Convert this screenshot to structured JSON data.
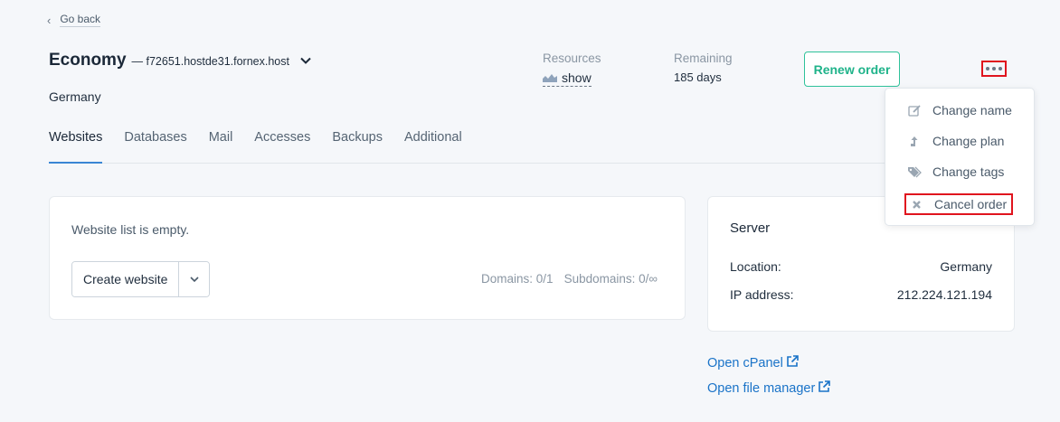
{
  "nav": {
    "back_label": "Go back"
  },
  "header": {
    "plan": "Economy",
    "host": "— f72651.hostde31.fornex.host",
    "country": "Germany",
    "resources_label": "Resources",
    "resources_value": "show",
    "remaining_label": "Remaining",
    "remaining_value": "185 days",
    "renew_label": "Renew order"
  },
  "tabs": [
    {
      "label": "Websites",
      "active": true
    },
    {
      "label": "Databases"
    },
    {
      "label": "Mail"
    },
    {
      "label": "Accesses"
    },
    {
      "label": "Backups"
    },
    {
      "label": "Additional"
    }
  ],
  "websites": {
    "empty_text": "Website list is empty.",
    "create_label": "Create website",
    "domains": "Domains: 0/1",
    "subdomains": "Subdomains: 0/∞"
  },
  "server": {
    "title": "Server",
    "location_label": "Location:",
    "location_value": "Germany",
    "ip_label": "IP address:",
    "ip_value": "212.224.121.194"
  },
  "links": {
    "cpanel": "Open cPanel",
    "file_manager": "Open file manager"
  },
  "menu": {
    "items": [
      {
        "label": "Change name",
        "icon": "edit-icon"
      },
      {
        "label": "Change plan",
        "icon": "upload-arrow-icon"
      },
      {
        "label": "Change tags",
        "icon": "tags-icon"
      },
      {
        "label": "Cancel order",
        "icon": "close-x-icon"
      }
    ]
  },
  "colors": {
    "accent_green": "#1fb38a",
    "link_blue": "#1a73c8",
    "tab_active": "#3a86d4",
    "highlight_red": "#e0141e"
  }
}
